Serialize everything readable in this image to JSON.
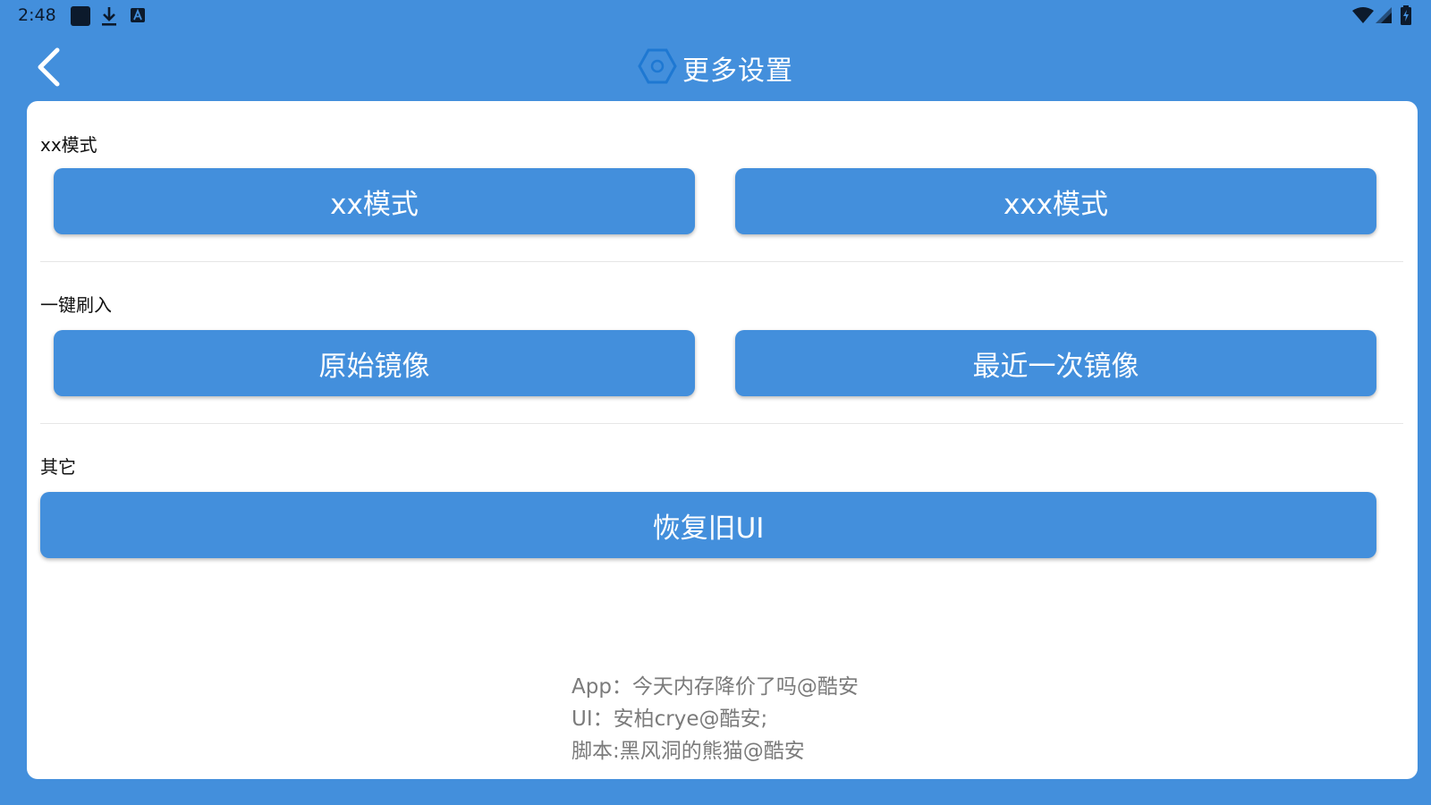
{
  "status_bar": {
    "time": "2:48",
    "icons": [
      "app-notification-icon",
      "download-icon",
      "keyboard-a-icon",
      "wifi-icon",
      "cell-signal-icon",
      "battery-charging-icon"
    ]
  },
  "header": {
    "title": "更多设置",
    "back_icon": "chevron-left-icon",
    "title_icon": "hexagon-icon"
  },
  "sections": [
    {
      "label": "xx模式",
      "buttons": [
        "xx模式",
        "xxx模式"
      ]
    },
    {
      "label": "一键刷入",
      "buttons": [
        "原始镜像",
        "最近一次镜像"
      ]
    },
    {
      "label": "其它",
      "buttons": [
        "恢复旧UI"
      ]
    }
  ],
  "footer": {
    "lines": [
      "App：今天内存降价了吗@酷安",
      "UI：安柏crye@酷安;",
      "脚本:黑风洞的熊猫@酷安"
    ]
  },
  "colors": {
    "primary": "#438fdc",
    "card": "#ffffff",
    "footer_text": "#7b7b7b",
    "divider": "#e6e6e6"
  }
}
